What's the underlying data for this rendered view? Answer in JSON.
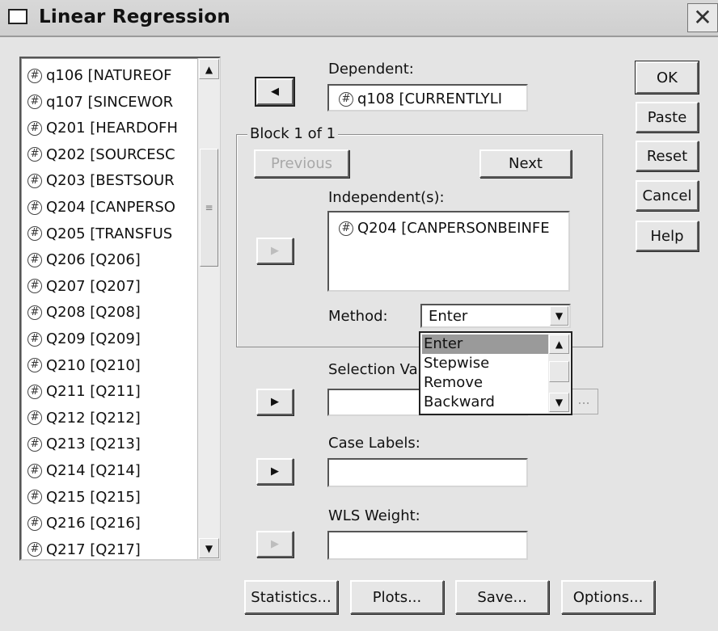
{
  "window": {
    "title": "Linear Regression",
    "close_glyph": "✕"
  },
  "variables": [
    "q106 [NATUREOF",
    "q107 [SINCEWOR",
    "Q201 [HEARDOFH",
    "Q202 [SOURCESC",
    "Q203 [BESTSOUR",
    "Q204 [CANPERSO",
    "Q205 [TRANSFUS",
    "Q206 [Q206]",
    "Q207 [Q207]",
    "Q208 [Q208]",
    "Q209 [Q209]",
    "Q210 [Q210]",
    "Q211 [Q211]",
    "Q212 [Q212]",
    "Q213 [Q213]",
    "Q214 [Q214]",
    "Q215 [Q215]",
    "Q216 [Q216]",
    "Q217 [Q217]"
  ],
  "variable_icon": "scale-variable-icon",
  "dependent": {
    "label": "Dependent:",
    "value": "q108 [CURRENTLYLI"
  },
  "block": {
    "caption": "Block 1 of 1",
    "previous_label": "Previous",
    "next_label": "Next",
    "independents_label": "Independent(s):",
    "independents": [
      "Q204 [CANPERSONBEINFE"
    ]
  },
  "method": {
    "label": "Method:",
    "selected": "Enter",
    "options": [
      "Enter",
      "Stepwise",
      "Remove",
      "Backward"
    ]
  },
  "selection_variable": {
    "label": "Selection Va",
    "value": "",
    "rule_button": "..."
  },
  "case_labels": {
    "label": "Case Labels:",
    "value": ""
  },
  "wls_weight": {
    "label": "WLS Weight:",
    "value": ""
  },
  "side_buttons": {
    "ok": "OK",
    "paste": "Paste",
    "reset": "Reset",
    "cancel": "Cancel",
    "help": "Help"
  },
  "bottom_buttons": {
    "statistics": "Statistics...",
    "plots": "Plots...",
    "save": "Save...",
    "options": "Options..."
  },
  "icons": {
    "left_arrow": "◀",
    "right_arrow": "▶",
    "up": "▲",
    "down": "▼",
    "grip": "≡",
    "var": "#"
  }
}
